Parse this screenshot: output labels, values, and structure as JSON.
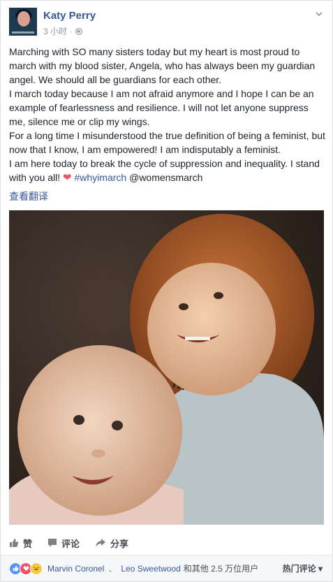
{
  "post": {
    "author": "Katy Perry",
    "time": "3 小时",
    "dot": "·",
    "paragraphs": [
      "Marching with SO many sisters today but my heart is most proud to march with my blood sister, Angela, who has always been my guardian angel. We should all be guardians for each other.",
      "I march today because I am not afraid anymore and I hope I can be an example of fearlessness and resilience. I will not let anyone suppress me, silence me or clip my wings.",
      "For a long time I misunderstood the true definition of being a feminist, but now that I know, I am empowered! I am indisputably a feminist.",
      "I am here today to break the cycle of suppression and inequality. I stand with you all!"
    ],
    "heart": "❤",
    "hashtag": "#whyimarch",
    "mention": "@womensmarch",
    "translate": "查看翻译"
  },
  "actions": {
    "like": "赞",
    "comment": "评论",
    "share": "分享"
  },
  "reactions": {
    "liker1": "Marvin Coronel",
    "separator": "、",
    "liker2": "Leo Sweetwood",
    "others": "和其他 2.5 万位用户",
    "sort": "热门评论 ▾"
  },
  "icons": {
    "globe": "globe-icon",
    "chevron": "chevron-down-icon",
    "like": "thumbs-up-icon",
    "comment": "comment-icon",
    "share": "share-arrow-icon"
  },
  "colors": {
    "link": "#365899",
    "like_reaction": "#5890ff",
    "love_reaction": "#f25268",
    "haha_reaction": "#f7c843"
  }
}
